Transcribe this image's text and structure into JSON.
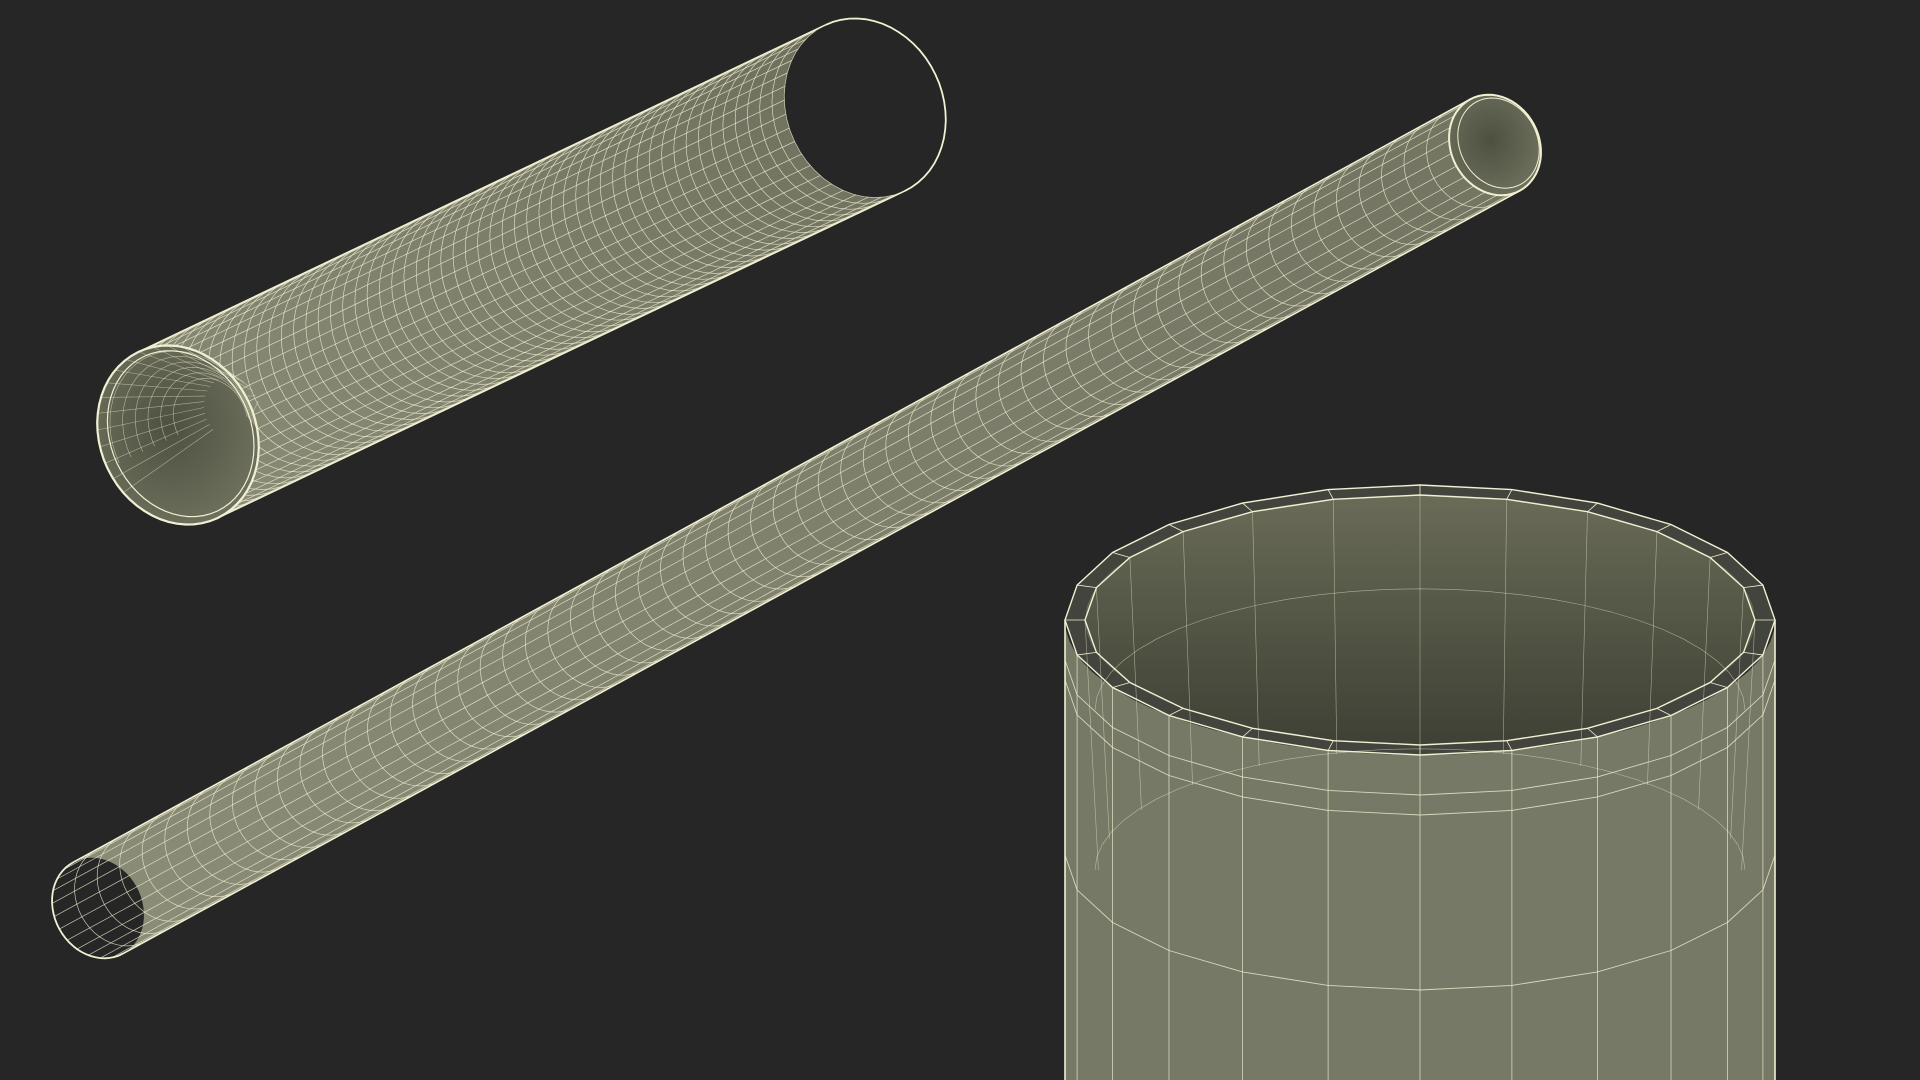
{
  "scene": {
    "background_color": "#262626",
    "wire_color": "#f1f0d2",
    "surface_color": "#7b7d69",
    "inner_color": "#666855",
    "objects": [
      {
        "name": "short-tube-wireframe",
        "segments": 40,
        "rings": 56
      },
      {
        "name": "long-tube-wireframe",
        "segments": 24,
        "rings": 62
      },
      {
        "name": "tube-closeup-wireframe",
        "segments": 24,
        "rings": 5
      }
    ]
  }
}
